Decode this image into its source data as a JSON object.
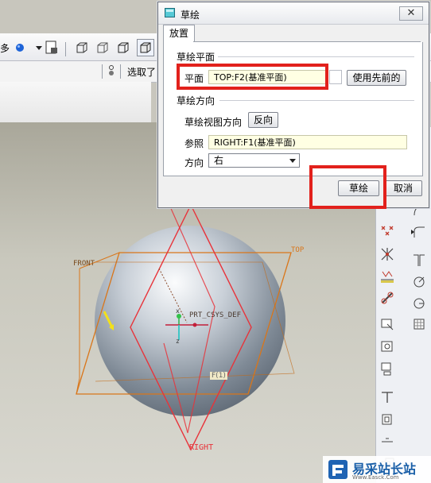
{
  "dialog": {
    "title": "草绘",
    "close_glyph": "✕",
    "tab": "放置",
    "sketch_plane_group": "草绘平面",
    "plane_label": "平面",
    "plane_value": "TOP:F2(基准平面)",
    "use_previous_button": "使用先前的",
    "orientation_group": "草绘方向",
    "view_direction_label": "草绘视图方向",
    "flip_button": "反向",
    "reference_label": "参照",
    "reference_value": "RIGHT:F1(基准平面)",
    "direction_label": "方向",
    "direction_value": "右",
    "sketch_button": "草绘",
    "cancel_button": "取消"
  },
  "toolbar": {
    "partial_text": "多",
    "selected_text": "选取了"
  },
  "viewport": {
    "datum_front": "FRONT",
    "datum_top": "TOP",
    "datum_right": "RIGHT",
    "csys_label": "PRT_CSYS_DEF",
    "axis_x": "x",
    "axis_z": "z",
    "datum_badge": "F(1)"
  },
  "watermark": {
    "text": "易采站长站",
    "sub": "Www.Easck.Com"
  },
  "colors": {
    "highlight_red": "#e2211c",
    "datum_orange": "#d9761a",
    "datum_red": "#e8333a",
    "field_yellow": "#ffffe3"
  }
}
